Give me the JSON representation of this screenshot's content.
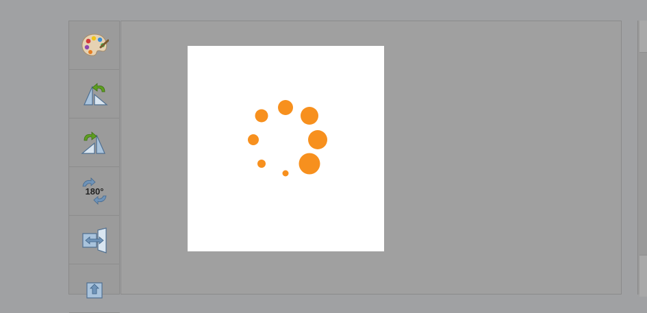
{
  "toolbar": {
    "buttons": [
      {
        "icon": "palette-icon"
      },
      {
        "icon": "flip-left-icon"
      },
      {
        "icon": "flip-right-icon"
      },
      {
        "icon": "rotate-180-icon",
        "label": "180°"
      },
      {
        "icon": "mirror-horizontal-icon"
      },
      {
        "icon": "mirror-vertical-icon"
      }
    ]
  },
  "preview": {
    "spinner_color": "#f7901e",
    "state": "loading"
  },
  "colors": {
    "background": "#a0a1a3",
    "accent": "#f7901e",
    "arrow_green": "#5e9e21",
    "icon_blue": "#6f93b8"
  }
}
